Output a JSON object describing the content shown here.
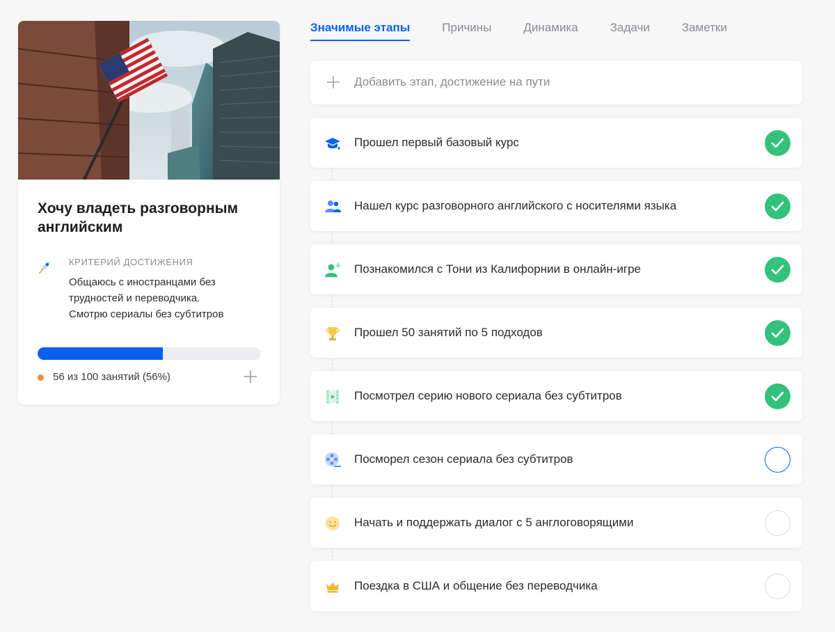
{
  "goal": {
    "title": "Хочу владеть разговорным английским",
    "criterion_label": "КРИТЕРИЙ ДОСТИЖЕНИЯ",
    "criterion_text": "Общаюсь с иностранцами без\nтрудностей и переводчика.\nСмотрю сериалы без субтитров",
    "progress_text": "56 из 100 занятий (56%)",
    "progress_fraction": 0.56,
    "image": "city-flag-photo"
  },
  "tabs": [
    {
      "label": "Значимые этапы",
      "active": true
    },
    {
      "label": "Причины",
      "active": false
    },
    {
      "label": "Динамика",
      "active": false
    },
    {
      "label": "Задачи",
      "active": false
    },
    {
      "label": "Заметки",
      "active": false
    }
  ],
  "add_milestone": {
    "label": "Добавить этап, достижение на пути",
    "icon": "plus-icon"
  },
  "milestones": [
    {
      "label": "Прошел первый базовый курс",
      "icon": "graduation-cap-icon",
      "status": "done"
    },
    {
      "label": "Нашел курс разговорного английского с носителями языка",
      "icon": "group-icon",
      "status": "done"
    },
    {
      "label": "Познакомился с Тони из Калифорнии в онлайн-игре",
      "icon": "add-user-icon",
      "status": "done"
    },
    {
      "label": "Прошел 50 занятий по 5 подходов",
      "icon": "trophy-icon",
      "status": "done"
    },
    {
      "label": "Посмотрел серию нового сериала без субтитров",
      "icon": "film-icon",
      "status": "done"
    },
    {
      "label": "Посморел сезон сериала без субтитров",
      "icon": "film-reel-icon",
      "status": "current"
    },
    {
      "label": "Начать и поддержать диалог с 5 англоговорящими",
      "icon": "smile-icon",
      "status": "todo"
    },
    {
      "label": "Поездка в США и общение без переводчика",
      "icon": "crown-icon",
      "status": "todo"
    }
  ],
  "colors": {
    "accent": "#0a61f0",
    "done": "#33c27c",
    "progress_dot": "#f08a3c"
  }
}
